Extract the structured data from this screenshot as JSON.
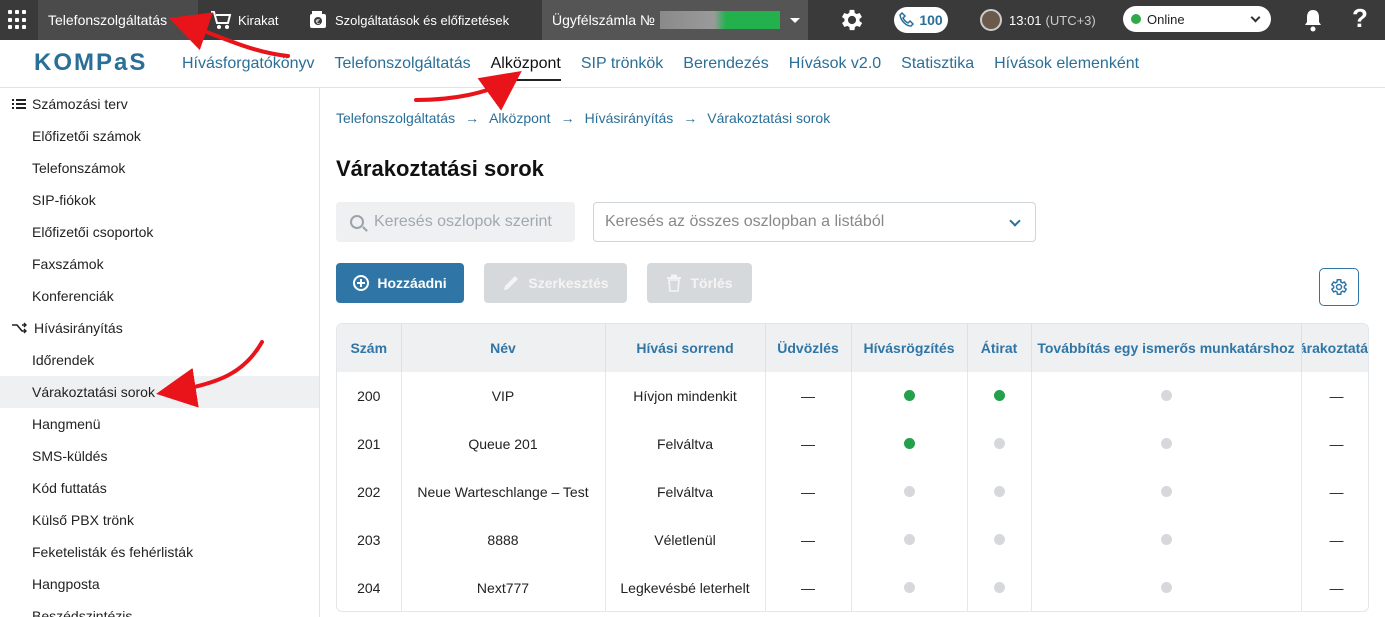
{
  "topbar": {
    "product": "Telefonszolgáltatás",
    "showcase": "Kirakat",
    "services": "Szolgáltatások és előfizetések",
    "account_label": "Ügyfélszámla №",
    "calls_count": "100",
    "time": "13:01",
    "timezone": "(UTC+3)",
    "status": "Online",
    "help": "?"
  },
  "nav": {
    "logo": "KOMPaS",
    "items": [
      "Hívásforgatókönyv",
      "Telefonszolgáltatás",
      "Alközpont",
      "SIP trönkök",
      "Berendezés",
      "Hívások v2.0",
      "Statisztika",
      "Hívások elemenként"
    ],
    "active_index": 2
  },
  "sidebar": {
    "group1": "Számozási terv",
    "group1_items": [
      "Előfizetői számok",
      "Telefonszámok",
      "SIP-fiókok",
      "Előfizetői csoportok",
      "Faxszámok",
      "Konferenciák"
    ],
    "group2": "Hívásirányítás",
    "group2_items": [
      "Időrendek",
      "Várakoztatási sorok",
      "Hangmenü",
      "SMS-küldés",
      "Kód futtatás",
      "Külső PBX trönk",
      "Feketelisták és fehérlisták",
      "Hangposta",
      "Beszédszintézis"
    ],
    "selected": "Várakoztatási sorok"
  },
  "breadcrumb": [
    "Telefonszolgáltatás",
    "Alközpont",
    "Hívásirányítás",
    "Várakoztatási sorok"
  ],
  "page": {
    "title": "Várakoztatási sorok",
    "search_col_placeholder": "Keresés oszlopok szerint",
    "search_all_placeholder": "Keresés az összes oszlopban a listából"
  },
  "toolbar": {
    "add": "Hozzáadni",
    "edit": "Szerkesztés",
    "delete": "Törlés"
  },
  "table": {
    "columns": [
      "Szám",
      "Név",
      "Hívási sorrend",
      "Üdvözlés",
      "Hívásrögzítés",
      "Átirat",
      "Továbbítás egy ismerős munkatárshoz",
      "Várakoztatási z"
    ],
    "rows": [
      {
        "num": "200",
        "name": "VIP",
        "order": "Hívjon mindenkit",
        "greeting": "—",
        "recording": true,
        "transcript": true,
        "forward": false,
        "last": "—"
      },
      {
        "num": "201",
        "name": "Queue 201",
        "order": "Felváltva",
        "greeting": "—",
        "recording": true,
        "transcript": false,
        "forward": false,
        "last": "—"
      },
      {
        "num": "202",
        "name": "Neue Warteschlange – Test",
        "order": "Felváltva",
        "greeting": "—",
        "recording": false,
        "transcript": false,
        "forward": false,
        "last": "—"
      },
      {
        "num": "203",
        "name": "8888",
        "order": "Véletlenül",
        "greeting": "—",
        "recording": false,
        "transcript": false,
        "forward": false,
        "last": "—"
      },
      {
        "num": "204",
        "name": "Next777",
        "order": "Legkevésbé leterhelt",
        "greeting": "—",
        "recording": false,
        "transcript": false,
        "forward": false,
        "last": "—"
      }
    ]
  },
  "colors": {
    "accent": "#2f76a6",
    "topbar": "#3a3a3a",
    "status_on": "#22a04b",
    "status_off": "#d6d8db",
    "annotation": "#e8141a"
  },
  "icons": [
    "apps-grid-icon",
    "cart-icon",
    "wallet-icon",
    "gear-icon",
    "phone-icon",
    "bell-icon",
    "help-icon",
    "list-icon",
    "routing-icon",
    "search-icon",
    "chevron-down-icon",
    "plus-circle-icon",
    "pencil-icon",
    "trash-icon",
    "table-settings-icon"
  ]
}
